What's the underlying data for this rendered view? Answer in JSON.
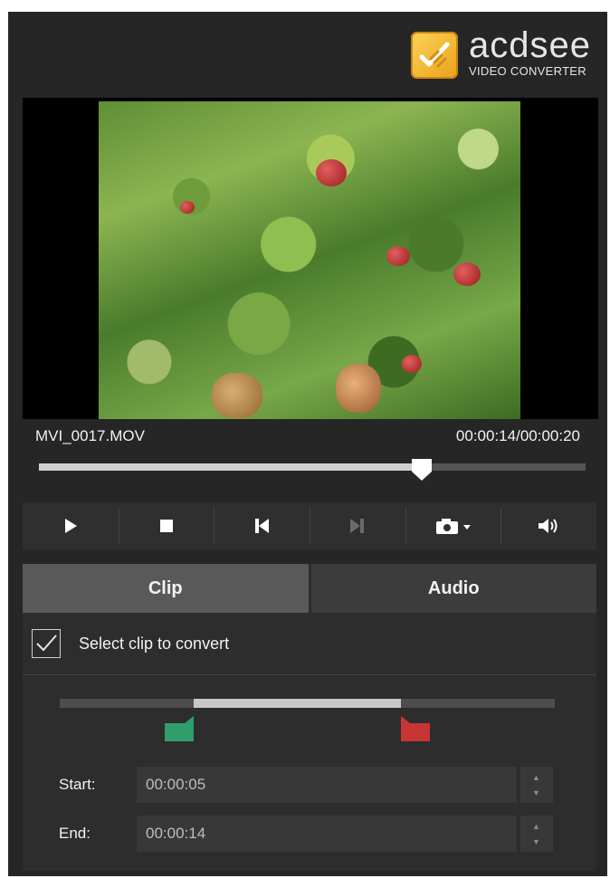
{
  "app": {
    "brand": "acdsee",
    "product": "VIDEO CONVERTER",
    "accent_color": "#f0b429"
  },
  "player": {
    "file_name": "MVI_0017.MOV",
    "time_readout": "00:00:14/00:00:20",
    "position_fraction": 0.7,
    "controls": [
      "play-icon",
      "stop-icon",
      "previous-frame-icon",
      "next-frame-icon",
      "camera-snapshot-icon",
      "volume-icon"
    ]
  },
  "tabs": [
    {
      "label": "Clip",
      "active": true
    },
    {
      "label": "Audio",
      "active": false
    }
  ],
  "clip": {
    "select_label": "Select clip to convert",
    "selected": true,
    "range_start_fraction": 0.27,
    "range_end_fraction": 0.69,
    "start_color": "#2f9e6a",
    "end_color": "#c93434",
    "start_label": "Start:",
    "start_value": "00:00:05",
    "end_label": "End:",
    "end_value": "00:00:14"
  }
}
